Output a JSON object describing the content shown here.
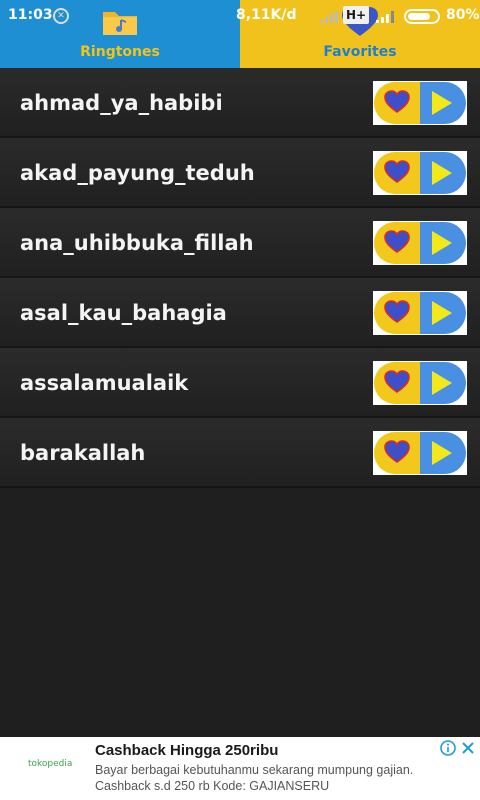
{
  "status_bar": {
    "time": "11:03",
    "notification_icon": "x-circle-icon",
    "network_speed": "8,11K/d",
    "network_type": "H+",
    "battery_level": 0.8,
    "battery_percent": "80%"
  },
  "tabs": [
    {
      "label": "Ringtones",
      "icon": "folder-music-icon",
      "color": "#1f8fd3",
      "active": true
    },
    {
      "label": "Favorites",
      "icon": "heart-icon",
      "color": "#f2c21c",
      "active": false
    }
  ],
  "songs": [
    {
      "title": "ahmad_ya_habibi"
    },
    {
      "title": "akad_payung_teduh"
    },
    {
      "title": "ana_uhibbuka_fillah"
    },
    {
      "title": "asal_kau_bahagia"
    },
    {
      "title": "assalamualaik"
    },
    {
      "title": "barakallah"
    }
  ],
  "row_buttons": {
    "favorite_icon": "heart-icon",
    "favorite_color": "#f2c81c",
    "play_icon": "play-icon",
    "play_color": "#4a90e2"
  },
  "ad": {
    "logo": "tokopedia",
    "title": "Cashback Hingga 250ribu",
    "description": "Bayar berbagai kebutuhanmu sekarang mumpung gajian. Cashback s.d 250 rb Kode: GAJIANSERU",
    "info_icon": "info-icon",
    "close_icon": "close-icon"
  }
}
